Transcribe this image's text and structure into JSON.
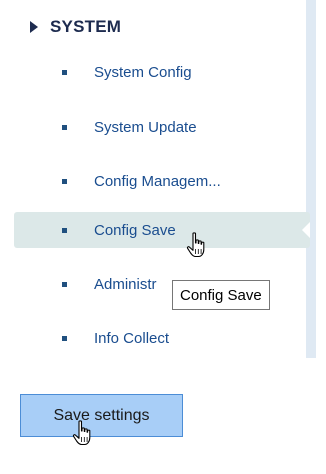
{
  "sidebar": {
    "section_title": "SYSTEM",
    "items": [
      {
        "label": "System Config"
      },
      {
        "label": "System Update"
      },
      {
        "label": "Config Managem..."
      },
      {
        "label": "Config Save"
      },
      {
        "label": "Administr"
      },
      {
        "label": "Info Collect"
      }
    ]
  },
  "tooltip": {
    "text": "Config Save"
  },
  "actions": {
    "save_label": "Save settings"
  },
  "colors": {
    "section_title": "#1d2b4f",
    "menu_text": "#1a4d8f",
    "active_bg": "#dce8e8",
    "button_bg": "#a8cef7",
    "button_border": "#4c8dd6",
    "rail": "#dfe9f3"
  },
  "icons": {
    "section_toggle": "triangle-right-icon",
    "pointer": "hand-pointer-icon",
    "bullet": "square-bullet-icon"
  }
}
